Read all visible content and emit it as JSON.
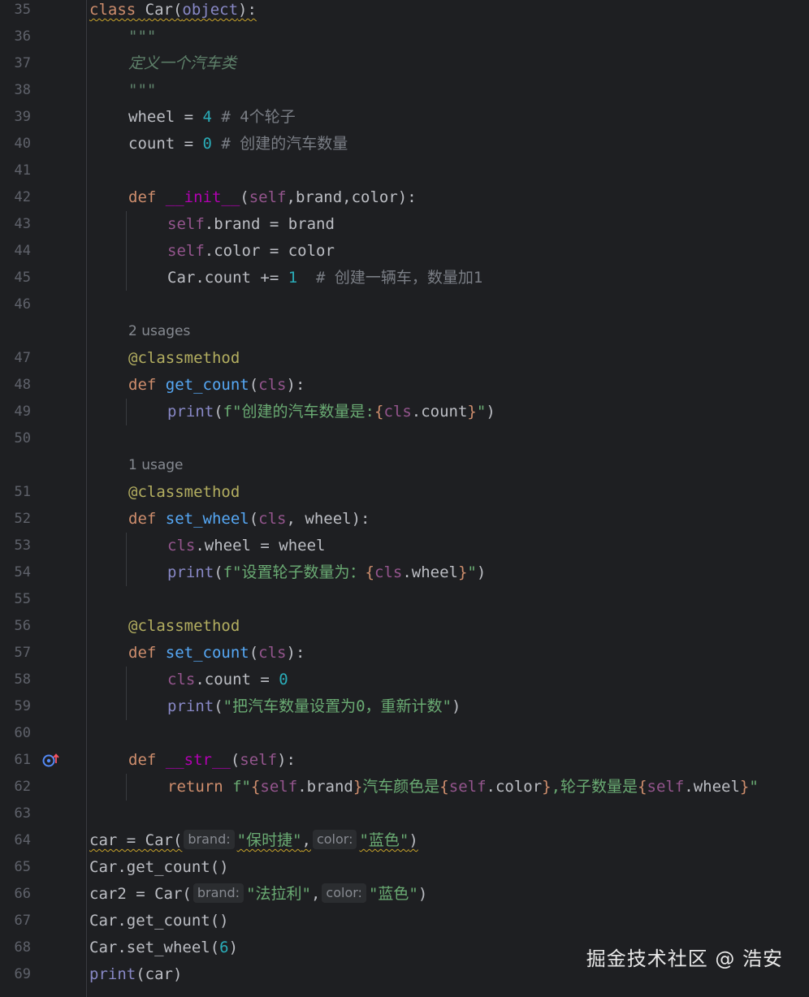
{
  "editor": {
    "usages": {
      "get_count": "2 usages",
      "set_wheel": "1 usage"
    },
    "lines": [
      {
        "n": "35",
        "t": [
          [
            "class ",
            "kw wavy"
          ],
          [
            "Car(",
            "wavy"
          ],
          [
            "object",
            "bi wavy"
          ],
          [
            "):",
            "wavy"
          ]
        ]
      },
      {
        "n": "36",
        "t": [
          [
            "\"\"\"",
            "doc"
          ]
        ]
      },
      {
        "n": "37",
        "t": [
          [
            "定义一个汽车类",
            "doc"
          ]
        ]
      },
      {
        "n": "38",
        "t": [
          [
            "\"\"\"",
            "doc"
          ]
        ]
      },
      {
        "n": "39",
        "t": [
          [
            "wheel = ",
            ""
          ],
          [
            "4",
            "num"
          ],
          [
            " # 4个轮子",
            "com"
          ]
        ]
      },
      {
        "n": "40",
        "t": [
          [
            "count = ",
            ""
          ],
          [
            "0",
            "num"
          ],
          [
            " # 创建的汽车数量",
            "com"
          ]
        ]
      },
      {
        "n": "41",
        "t": []
      },
      {
        "n": "42",
        "t": [
          [
            "def ",
            "kw"
          ],
          [
            "__init__",
            "dunder"
          ],
          [
            "(",
            ""
          ],
          [
            "self",
            "self"
          ],
          [
            ",brand,color):",
            ""
          ]
        ]
      },
      {
        "n": "43",
        "t": [
          [
            "self",
            "self"
          ],
          [
            ".brand = brand",
            ""
          ]
        ]
      },
      {
        "n": "44",
        "t": [
          [
            "self",
            "self"
          ],
          [
            ".color = color",
            ""
          ]
        ]
      },
      {
        "n": "45",
        "t": [
          [
            "Car.count += ",
            ""
          ],
          [
            "1",
            "num"
          ],
          [
            "  # 创建一辆车，数量加1",
            "com"
          ]
        ]
      },
      {
        "n": "46",
        "t": []
      },
      {
        "n": "47",
        "t": [
          [
            "@classmethod",
            "dec"
          ]
        ]
      },
      {
        "n": "48",
        "t": [
          [
            "def ",
            "kw"
          ],
          [
            "get_count",
            "fn"
          ],
          [
            "(",
            ""
          ],
          [
            "cls",
            "self"
          ],
          [
            "):",
            ""
          ]
        ]
      },
      {
        "n": "49",
        "t": [
          [
            "print",
            "bi"
          ],
          [
            "(",
            ""
          ],
          [
            "f\"创建的汽车数量是:",
            "str"
          ],
          [
            "{",
            "brace"
          ],
          [
            "cls",
            "self"
          ],
          [
            ".count",
            ""
          ],
          [
            "}",
            "brace"
          ],
          [
            "\"",
            "str"
          ],
          [
            ")",
            ""
          ]
        ]
      },
      {
        "n": "50",
        "t": []
      },
      {
        "n": "51",
        "t": [
          [
            "@classmethod",
            "dec"
          ]
        ]
      },
      {
        "n": "52",
        "t": [
          [
            "def ",
            "kw"
          ],
          [
            "set_wheel",
            "fn"
          ],
          [
            "(",
            ""
          ],
          [
            "cls",
            "self"
          ],
          [
            ", wheel):",
            ""
          ]
        ]
      },
      {
        "n": "53",
        "t": [
          [
            "cls",
            "self"
          ],
          [
            ".wheel = wheel",
            ""
          ]
        ]
      },
      {
        "n": "54",
        "t": [
          [
            "print",
            "bi"
          ],
          [
            "(",
            ""
          ],
          [
            "f\"设置轮子数量为：",
            "str"
          ],
          [
            "{",
            "brace"
          ],
          [
            "cls",
            "self"
          ],
          [
            ".wheel",
            ""
          ],
          [
            "}",
            "brace"
          ],
          [
            "\"",
            "str"
          ],
          [
            ")",
            ""
          ]
        ]
      },
      {
        "n": "55",
        "t": []
      },
      {
        "n": "56",
        "t": [
          [
            "@classmethod",
            "dec"
          ]
        ]
      },
      {
        "n": "57",
        "t": [
          [
            "def ",
            "kw"
          ],
          [
            "set_count",
            "fn"
          ],
          [
            "(",
            ""
          ],
          [
            "cls",
            "self"
          ],
          [
            "):",
            ""
          ]
        ]
      },
      {
        "n": "58",
        "t": [
          [
            "cls",
            "self"
          ],
          [
            ".count = ",
            ""
          ],
          [
            "0",
            "num"
          ]
        ]
      },
      {
        "n": "59",
        "t": [
          [
            "print",
            "bi"
          ],
          [
            "(",
            ""
          ],
          [
            "\"把汽车数量设置为0，重新计数\"",
            "str"
          ],
          [
            ")",
            ""
          ]
        ]
      },
      {
        "n": "60",
        "t": []
      },
      {
        "n": "61",
        "t": [
          [
            "def ",
            "kw"
          ],
          [
            "__str__",
            "dunder"
          ],
          [
            "(",
            ""
          ],
          [
            "self",
            "self"
          ],
          [
            "):",
            ""
          ]
        ]
      },
      {
        "n": "62",
        "t": [
          [
            "return ",
            "kw"
          ],
          [
            "f\"",
            "str"
          ],
          [
            "{",
            "brace"
          ],
          [
            "self",
            "self"
          ],
          [
            ".brand",
            ""
          ],
          [
            "}",
            "brace"
          ],
          [
            "汽车颜色是",
            "str"
          ],
          [
            "{",
            "brace"
          ],
          [
            "self",
            "self"
          ],
          [
            ".color",
            ""
          ],
          [
            "}",
            "brace"
          ],
          [
            ",轮子数量是",
            "str"
          ],
          [
            "{",
            "brace"
          ],
          [
            "self",
            "self"
          ],
          [
            ".wheel",
            ""
          ],
          [
            "}",
            "brace"
          ],
          [
            "\"",
            "str"
          ]
        ]
      },
      {
        "n": "63",
        "t": []
      },
      {
        "n": "64",
        "t": [
          [
            "car = Car(",
            "wavy"
          ],
          [
            "brand:",
            "hint"
          ],
          [
            "\"保时捷\"",
            "str wavy"
          ],
          [
            ",",
            "wavy"
          ],
          [
            "color:",
            "hint"
          ],
          [
            "\"蓝色\"",
            "str wavy"
          ],
          [
            ")",
            "wavy"
          ]
        ]
      },
      {
        "n": "65",
        "t": [
          [
            "Car.get_count()",
            ""
          ]
        ]
      },
      {
        "n": "66",
        "t": [
          [
            "car2 = Car(",
            ""
          ],
          [
            "brand:",
            "hint"
          ],
          [
            "\"法拉利\"",
            "str"
          ],
          [
            ",",
            ""
          ],
          [
            "color:",
            "hint"
          ],
          [
            "\"蓝色\"",
            "str"
          ],
          [
            ")",
            ""
          ]
        ]
      },
      {
        "n": "67",
        "t": [
          [
            "Car.get_count()",
            ""
          ]
        ]
      },
      {
        "n": "68",
        "t": [
          [
            "Car.set_wheel(",
            ""
          ],
          [
            "6",
            "num"
          ],
          [
            ")",
            ""
          ]
        ]
      },
      {
        "n": "69",
        "t": [
          [
            "print",
            "bi"
          ],
          [
            "(car)",
            ""
          ]
        ]
      }
    ]
  },
  "gutter": {
    "override_icon": "override-method-icon"
  },
  "watermark": "掘金技术社区 @ 浩安",
  "colors": {
    "background": "#1e1f22",
    "text": "#bcbec4",
    "keyword": "#cf8e6d",
    "function": "#56a8f5",
    "string": "#6aab73",
    "number": "#2aacb8",
    "self": "#94558d",
    "decorator": "#b3ae60",
    "comment": "#7a7e85",
    "dunder": "#b200b2",
    "builtin": "#8888c6",
    "line_number": "#5f626b"
  }
}
